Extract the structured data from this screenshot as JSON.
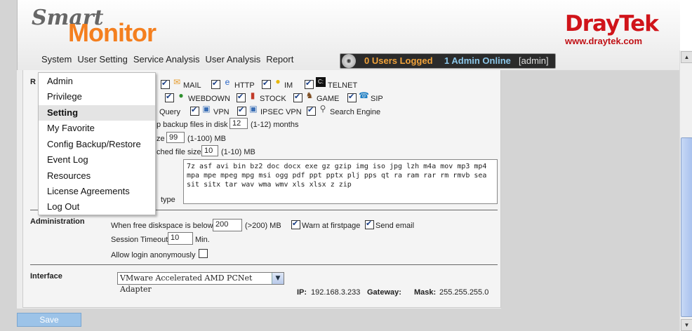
{
  "header": {
    "logo_smart": "Smart",
    "logo_monitor": "Monitor",
    "brand": "DrayTek",
    "brand_url": "www.draytek.com"
  },
  "menu": [
    "System",
    "User Setting",
    "Service Analysis",
    "User Analysis",
    "Report"
  ],
  "status": {
    "users_logged": "0 Users Logged",
    "admin_online": "1 Admin Online",
    "admin_tag": "[admin]"
  },
  "dropdown": {
    "items": [
      "Admin",
      "Privilege",
      "Setting",
      "My Favorite",
      "Config Backup/Restore",
      "Event Log",
      "Resources",
      "License Agreements",
      "Log Out"
    ],
    "active_index": 2
  },
  "record": {
    "section_label_partial": "R",
    "row1": [
      "MAIL",
      "HTTP",
      "IM",
      "TELNET"
    ],
    "row2": [
      "WEBDOWN",
      "STOCK",
      "GAME",
      "SIP"
    ],
    "row3": [
      "Query",
      "VPN",
      "IPSEC VPN",
      "Search Engine"
    ],
    "backup_label": "p backup files in disk",
    "backup_value": "12",
    "backup_range": "(1-12) months",
    "size_label": "ze",
    "size_value": "99",
    "size_range": "(1-100)  MB",
    "fsize_label": "ched file size",
    "fsize_value": "10",
    "fsize_range": "(1-10)  MB",
    "types_label": "type",
    "file_types": "7z asf avi bin bz2 doc docx exe gz gzip img iso jpg lzh m4a mov mp3 mp4 mpa mpe mpeg mpg msi ogg pdf ppt pptx plj pps qt ra ram rar rm rmvb sea sit sitx tar wav wma wmv xls xlsx z zip"
  },
  "administration": {
    "title": "Administration",
    "diskspace_label": "When free diskspace is below",
    "diskspace_value": "200",
    "diskspace_unit": "(>200) MB",
    "warn_label": "Warn at firstpage",
    "email_label": "Send email",
    "timeout_label": "Session Timeout",
    "timeout_value": "10",
    "timeout_unit": "Min.",
    "anon_label": "Allow login anonymously"
  },
  "interface": {
    "title": "Interface",
    "selected": "VMware Accelerated AMD PCNet Adapter",
    "ip_label": "IP:",
    "ip_value": "192.168.3.233",
    "gateway_label": "Gateway:",
    "gateway_value": "",
    "mask_label": "Mask:",
    "mask_value": "255.255.255.0"
  },
  "save_label": "Save"
}
